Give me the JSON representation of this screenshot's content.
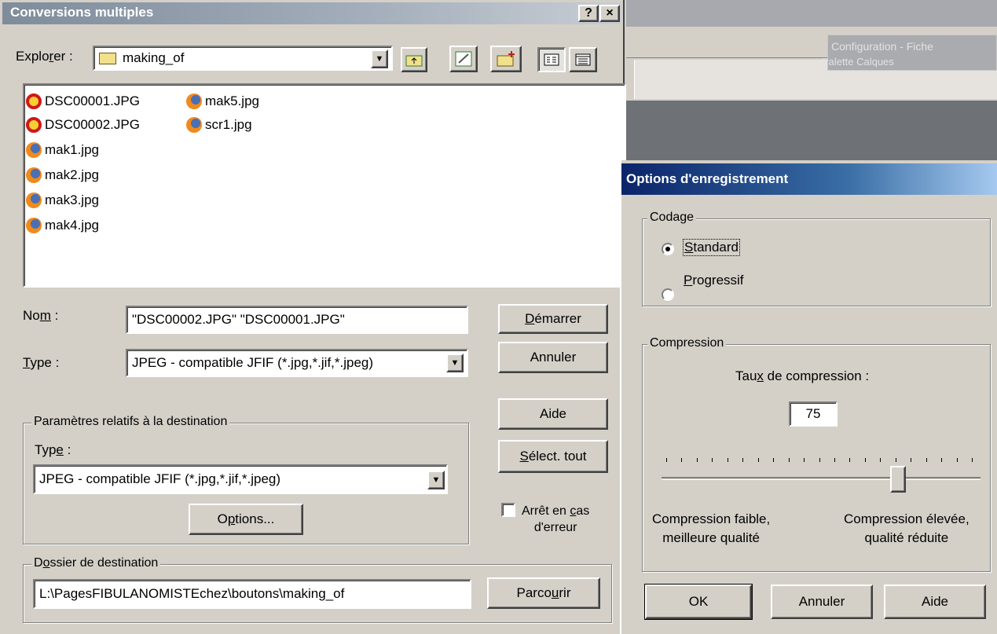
{
  "background_window": {
    "label1": "Configuration - Fiche",
    "label2": "Palette Calques"
  },
  "left_dialog": {
    "title": "Conversions multiples",
    "help_btn": "?",
    "close_btn": "×",
    "explorer": {
      "label_pre": "Explo",
      "label_u": "r",
      "label_post": "er :",
      "folder": "making_of"
    },
    "files": [
      {
        "name": "DSC00001.JPG",
        "icon": "camera-icon"
      },
      {
        "name": "DSC00002.JPG",
        "icon": "camera-icon"
      },
      {
        "name": "mak1.jpg",
        "icon": "firefox-icon"
      },
      {
        "name": "mak2.jpg",
        "icon": "firefox-icon"
      },
      {
        "name": "mak3.jpg",
        "icon": "firefox-icon"
      },
      {
        "name": "mak4.jpg",
        "icon": "firefox-icon"
      },
      {
        "name": "mak5.jpg",
        "icon": "firefox-icon"
      },
      {
        "name": "scr1.jpg",
        "icon": "firefox-icon"
      }
    ],
    "nom": {
      "label_pre": "No",
      "label_u": "m",
      "label_post": " :",
      "value": "\"DSC00002.JPG\" \"DSC00001.JPG\""
    },
    "type": {
      "label_u": "T",
      "label_post": "ype :",
      "value": "JPEG - compatible JFIF (*.jpg,*.jif,*.jpeg)"
    },
    "buttons": {
      "demarrer_u": "D",
      "demarrer_rest": "émarrer",
      "annuler": "Annuler",
      "aide": "Aide",
      "select_u": "S",
      "select_rest": "élect. tout"
    },
    "dest_params": {
      "group_label": "Paramètres relatifs à la destination",
      "type_pre": "Typ",
      "type_u": "e",
      "type_post": " :",
      "type_value": "JPEG - compatible JFIF (*.jpg,*.jif,*.jpeg)",
      "options_pre": "O",
      "options_u": "p",
      "options_post": "tions..."
    },
    "stop_on_error": {
      "line1_pre": "Arrêt en ",
      "line1_u": "c",
      "line1_post": "as",
      "line2": "d'erreur",
      "checked": false
    },
    "dest_folder": {
      "group_pre": "D",
      "group_u": "o",
      "group_post": "ssier de destination",
      "path": "L:\\PagesFIBULANOMISTEchez\\boutons\\making_of",
      "browse_pre": "Parco",
      "browse_u": "u",
      "browse_post": "rir"
    }
  },
  "right_dialog": {
    "title": "Options d'enregistrement",
    "codage": {
      "group_label": "Codage",
      "standard_u": "S",
      "standard_rest": "tandard",
      "progressif_u": "P",
      "progressif_rest": "rogressif",
      "selected": "Standard"
    },
    "compression": {
      "group_label": "Compression",
      "rate_pre": "Tau",
      "rate_u": "x",
      "rate_post": " de compression :",
      "value": "75",
      "slider_fraction": 0.75,
      "left_line1": "Compression faible,",
      "left_line2": "meilleure qualité",
      "right_line1": "Compression élevée,",
      "right_line2": "qualité réduite"
    },
    "buttons": {
      "ok": "OK",
      "annuler": "Annuler",
      "aide": "Aide"
    }
  },
  "colors": {
    "face": "#d4d0c8",
    "active_title": "#0a246a",
    "inactive_title": "#7f8c9b"
  }
}
